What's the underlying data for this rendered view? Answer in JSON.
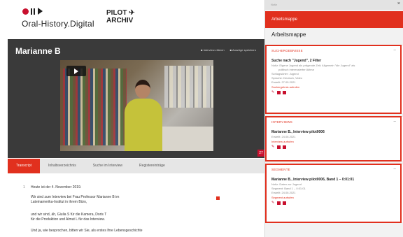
{
  "header": {
    "logo_text": "Oral-History.Digital",
    "partner_line1": "PILOT ✈",
    "partner_line2": "ARCHIV"
  },
  "stage": {
    "title": "Marianne B",
    "action1": "Interview zitieren",
    "action2": "Auszüge speichern",
    "badge": "27"
  },
  "tabs": [
    {
      "label": "Transcript",
      "active": true
    },
    {
      "label": "Inhaltsverzeichnis"
    },
    {
      "label": "Suche im Interview"
    },
    {
      "label": "Registereinträge"
    }
  ],
  "transcript": {
    "timecode": "1",
    "lines": [
      "Heute ist der 4. November 2019.",
      "Wir sind zum Interview bei Frau Professor Marianne B    im",
      "Lateinamerika-Institut in ihrem Büro,",
      "und wir sind, äh, Giulia S      für die Kamera, Doris T",
      "für die Produktion und Almut L      für das Interview.",
      "Und ja, wie besprochen, bitten wir Sie, als erstes Ihre Lebensgeschichte"
    ]
  },
  "panel": {
    "top_label": "Notiz",
    "close": "×",
    "header": "Arbeitsmappe",
    "title": "Arbeitsmappe",
    "cards": [
      {
        "head": "Suchergebnisse",
        "title": "Suche nach \"Jugend\", 2 Filter",
        "meta": [
          "Notiz: Eigene Jugend als prägende Zeit; Allgemein \"die Jugend\" als",
          "politisch interessierter Akteur",
          "Schlagwörter: Jugend",
          "Sprache: Deutsch, Video",
          "Erstellt: 27.05.2021"
        ],
        "link": "Suchergebnis aufrufen"
      },
      {
        "head": "Interviews",
        "title": "Marianne B., Interview pilot0006",
        "meta": [
          "Erstellt: 24.06.2021"
        ],
        "link": "Interview aufrufen"
      },
      {
        "head": "Segmente",
        "title": "Marianne B., Interview pilot0006, Band 1 – 0:01:01",
        "meta": [
          "Notiz: Daten zur Jugend",
          "Segment: Band 1 – 0:01:01",
          "Erstellt: 24.06.2021"
        ],
        "link": "Segment aufrufen"
      }
    ]
  },
  "colors": {
    "accent": "#e1301e",
    "brand": "#c8102e",
    "stage": "#3a3a3a"
  }
}
